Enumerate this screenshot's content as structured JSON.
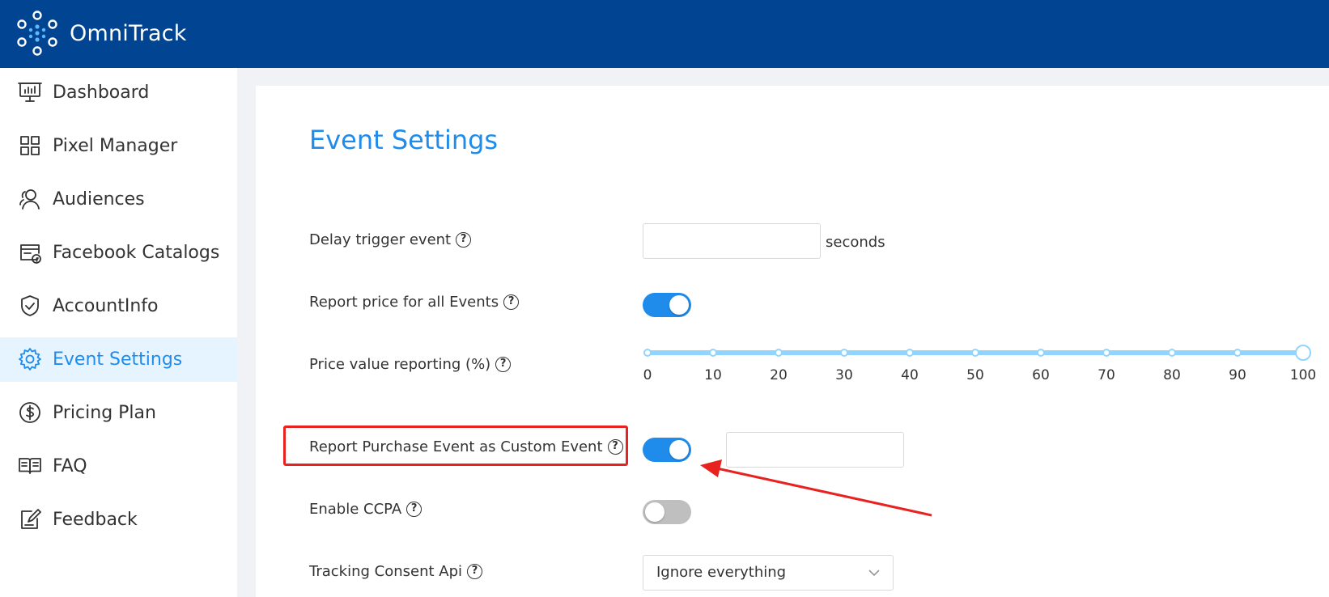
{
  "app": {
    "brand_name": "OmniTrack"
  },
  "sidebar": {
    "items": [
      {
        "label": "Dashboard",
        "icon": "dashboard-icon",
        "active": false
      },
      {
        "label": "Pixel Manager",
        "icon": "grid-icon",
        "active": false
      },
      {
        "label": "Audiences",
        "icon": "users-icon",
        "active": false
      },
      {
        "label": "Facebook Catalogs",
        "icon": "catalog-icon",
        "active": false
      },
      {
        "label": "AccountInfo",
        "icon": "shield-icon",
        "active": false
      },
      {
        "label": "Event Settings",
        "icon": "gear-icon",
        "active": true
      },
      {
        "label": "Pricing Plan",
        "icon": "dollar-icon",
        "active": false
      },
      {
        "label": "FAQ",
        "icon": "book-icon",
        "active": false
      },
      {
        "label": "Feedback",
        "icon": "feedback-icon",
        "active": false
      }
    ]
  },
  "main": {
    "title": "Event Settings",
    "delay": {
      "label": "Delay trigger event",
      "value": "",
      "suffix": "seconds"
    },
    "report_price": {
      "label": "Report price for all Events",
      "enabled": true
    },
    "price_value": {
      "label": "Price value reporting (%)",
      "value": 100,
      "marks": [
        "0",
        "10",
        "20",
        "30",
        "40",
        "50",
        "60",
        "70",
        "80",
        "90",
        "100"
      ]
    },
    "purchase_custom": {
      "label": "Report Purchase Event as Custom Event",
      "enabled": true,
      "value": ""
    },
    "ccpa": {
      "label": "Enable CCPA",
      "enabled": false
    },
    "consent_api": {
      "label": "Tracking Consent Api",
      "value": "Ignore everything"
    }
  },
  "colors": {
    "header": "#014492",
    "accent": "#1f8ceb",
    "active_bg": "#e6f4ff",
    "annotation": "#e8231f",
    "slider": "#91d5ff"
  }
}
